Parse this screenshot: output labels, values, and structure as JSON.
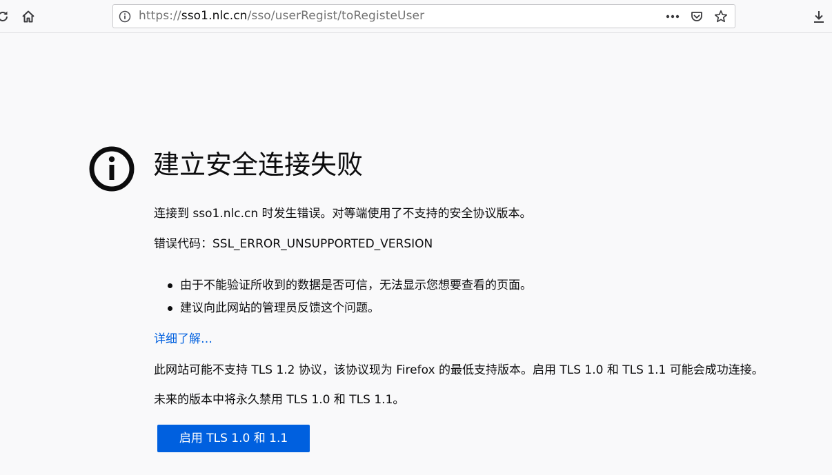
{
  "browser": {
    "url_prefix": "https://",
    "url_host": "sso1.nlc.cn",
    "url_path": "/sso/userRegist/toRegisteUser",
    "icons": {
      "reload": "reload-icon",
      "home": "home-icon",
      "info": "info-icon",
      "more": "more-actions-icon",
      "pocket": "pocket-icon",
      "bookmark": "bookmark-star-icon",
      "download": "download-icon"
    }
  },
  "error": {
    "icon": "info-circle-icon",
    "title": "建立安全连接失败",
    "description": "连接到 sso1.nlc.cn 时发生错误。对等端使用了不支持的安全协议版本。",
    "code_line": "错误代码：SSL_ERROR_UNSUPPORTED_VERSION",
    "bullets": [
      "由于不能验证所收到的数据是否可信，无法显示您想要查看的页面。",
      "建议向此网站的管理员反馈这个问题。"
    ],
    "learn_more": "详细了解…",
    "tls_note": "此网站可能不支持 TLS 1.2 协议，该协议现为 Firefox 的最低支持版本。启用 TLS 1.0 和 TLS 1.1 可能会成功连接。",
    "tls_future": "未来的版本中将永久禁用 TLS 1.0 和 TLS 1.1。",
    "enable_button": "启用 TLS 1.0 和 1.1"
  },
  "colors": {
    "accent": "#0060df",
    "background": "#f9f9fa",
    "text": "#0c0c0d"
  }
}
